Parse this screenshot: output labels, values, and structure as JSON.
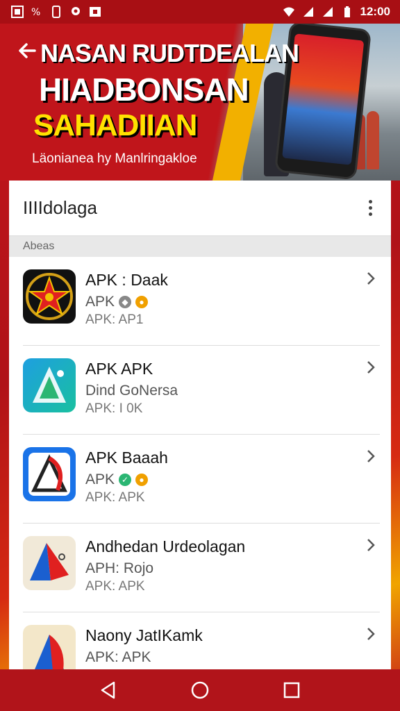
{
  "status_bar": {
    "time": "12:00",
    "left_icons": [
      "gallery-icon",
      "settings-icon",
      "phone-icon",
      "location-icon",
      "screenshot-icon"
    ],
    "right_icons": [
      "wifi-icon",
      "signal-icon",
      "signal-icon",
      "battery-icon"
    ]
  },
  "banner": {
    "line1": "NASAN RUDTDEALAN",
    "line2": "HIADBONSAN",
    "line3": "SAHADIIAN",
    "tagline": "Läonianea hy Manlringakloe"
  },
  "card": {
    "title": "IIIIdolaga",
    "section_label": "Abeas"
  },
  "apps": [
    {
      "name": "APK : Daak",
      "line2": "APK",
      "line3": "APK: AP1",
      "badges": [
        "grey-badge-icon",
        "orange-badge-icon"
      ]
    },
    {
      "name": "APK APK",
      "line2": "Dind GoNersa",
      "line3": "APK: I 0K",
      "badges": []
    },
    {
      "name": "APK Baaah",
      "line2": "APK",
      "line3": "APK: APK",
      "badges": [
        "green-badge-icon",
        "orange-badge-icon"
      ]
    },
    {
      "name": "Andhedan Urdeolagan",
      "line2": "APH: Rojo",
      "line3": "APK: APK",
      "badges": []
    },
    {
      "name": "Naony JatIKamk",
      "line2": "APK: APK",
      "line3": "",
      "badges": []
    }
  ],
  "colors": {
    "brand_red": "#c4161c",
    "accent_yellow": "#f2b000",
    "nav_red": "#b1141a"
  }
}
